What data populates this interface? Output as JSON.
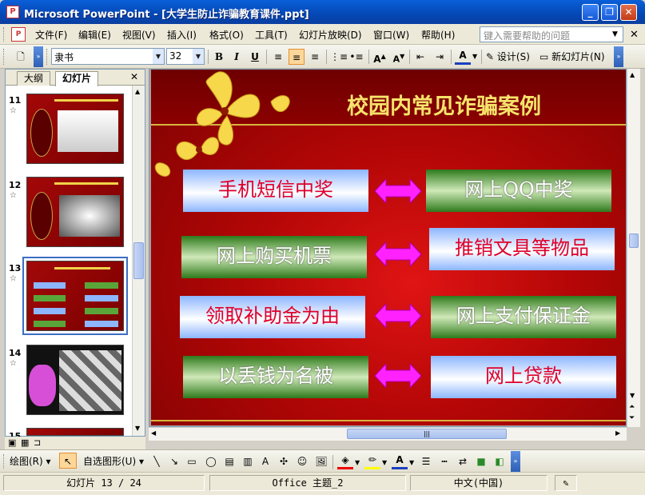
{
  "window": {
    "title": "Microsoft PowerPoint - [大学生防止诈骗教育课件.ppt]",
    "controls": [
      "minimize",
      "restore",
      "close"
    ]
  },
  "menubar": {
    "items": [
      "文件(F)",
      "编辑(E)",
      "视图(V)",
      "插入(I)",
      "格式(O)",
      "工具(T)",
      "幻灯片放映(D)",
      "窗口(W)",
      "帮助(H)"
    ],
    "help_placeholder": "键入需要帮助的问题"
  },
  "toolbar": {
    "font_name": "隶书",
    "font_size": "32",
    "bold": "B",
    "italic": "I",
    "underline": "U",
    "design_label": "设计(S)",
    "new_slide_label": "新幻灯片(N)"
  },
  "leftpane": {
    "tabs": [
      "大纲",
      "幻灯片"
    ],
    "active_tab": "幻灯片",
    "slides": [
      {
        "num": "11"
      },
      {
        "num": "12"
      },
      {
        "num": "13",
        "selected": true
      },
      {
        "num": "14"
      },
      {
        "num": "15"
      }
    ]
  },
  "slide": {
    "title": "校园内常见诈骗案例",
    "pairs": [
      {
        "left": "手机短信中奖",
        "left_style": "blue",
        "right": "网上QQ中奖",
        "right_style": "green"
      },
      {
        "left": "网上购买机票",
        "left_style": "green",
        "right": "推销文具等物品",
        "right_style": "blue"
      },
      {
        "left": "领取补助金为由",
        "left_style": "blue",
        "right": "网上支付保证金",
        "right_style": "green"
      },
      {
        "left": "以丢钱为名被",
        "left_style": "green",
        "right": "网上贷款",
        "right_style": "blue"
      }
    ],
    "colors": {
      "background": "#b30606",
      "title": "#f6e36b",
      "arrow": "#ff22ff",
      "gold": "#d8b43d"
    }
  },
  "drawbar": {
    "draw_label": "绘图(R)",
    "autoshape_label": "自选图形(U)"
  },
  "statusbar": {
    "slide_info": "幻灯片 13 / 24",
    "theme": "Office 主题_2",
    "language": "中文(中国)"
  }
}
